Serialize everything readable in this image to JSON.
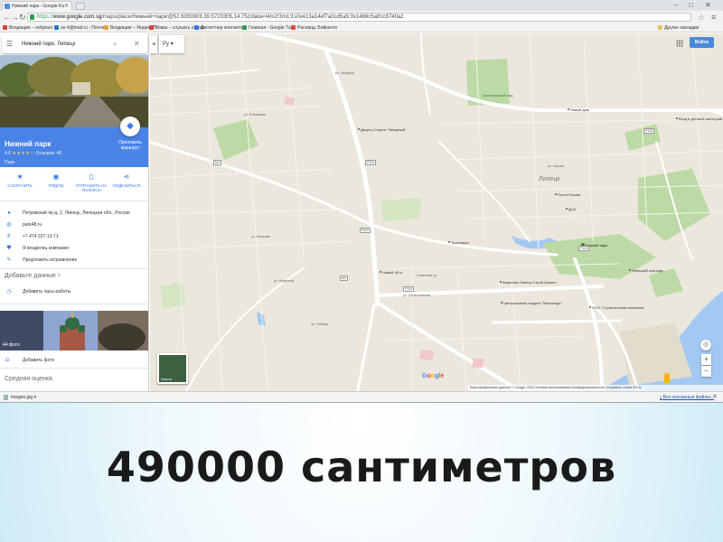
{
  "browser": {
    "tab_title": "Нижний парк - Google Ka",
    "address_scheme": "https://",
    "address_host": "www.google.com.sg",
    "address_path": "/maps/place/Нижний+парк/@52.6093903,39.5720305,14.75z/data=!4m2!3m1!1s0x413a14ef7a0cd5a5:0x14b6c5a81c8740a2",
    "bookmarks": [
      {
        "label": "Входящие – evbpezo",
        "color": "#d44638"
      },
      {
        "label": "ze-4@mail.ru - Почта",
        "color": "#2a77c7"
      },
      {
        "label": "Входящие – Яндекс.П",
        "color": "#e6a23c"
      },
      {
        "label": "Мама – слушать онлай",
        "color": "#d44638"
      },
      {
        "label": "Диспетчер контактов",
        "color": "#3b78e7"
      },
      {
        "label": "Главная - Google Таб",
        "color": "#2e9d4e"
      },
      {
        "label": "Рисовод: Бойкенто",
        "color": "#e04b36"
      }
    ],
    "other_bookmarks": "Другие закладки"
  },
  "panel": {
    "search_query": "Нижний парк, Липецк",
    "place_name": "Нижний парк",
    "rating": "4,6",
    "stars": "★★★★☆",
    "reviews": "Отзывов: 46",
    "place_type": "Парк",
    "route_label": "Проложить маршрут",
    "actions": [
      {
        "icon": "★",
        "label": "СОХРАНИТЬ",
        "name": "save"
      },
      {
        "icon": "◉",
        "label": "РЯДОМ",
        "name": "nearby"
      },
      {
        "icon": "▯",
        "label": "ОТПРАВИТЬ НА ТЕЛЕФОН",
        "name": "send-to-phone"
      },
      {
        "icon": "⋖",
        "label": "ПОДЕЛИТЬСЯ",
        "name": "share"
      }
    ],
    "address": "Петровский пр-д, 2, Липецк, Липецкая обл., Россия",
    "website": "park48.ru",
    "phone": "+7 474 227-13-71",
    "claim": "Я владелец компании",
    "suggest_edit": "Предложить исправление",
    "add_missing_title": "Добавьте данные",
    "add_hours": "Добавить часы работы",
    "photo_count": "44 фото",
    "add_photo": "Добавить фото",
    "avg_rating_title": "Средняя оценка"
  },
  "map": {
    "lang_label": "Ру",
    "signin_label": "Войти",
    "earth_label": "Земля",
    "city": "Липецк",
    "park_label": "Нижний парк",
    "labels": [
      {
        "text": "Дворец Спорта \"Звездный\"",
        "kind": "poi"
      },
      {
        "text": "Новый дом",
        "kind": "poi"
      },
      {
        "text": "Вход в детский санаторий Ростовский",
        "kind": "poi"
      },
      {
        "text": "Почта России",
        "kind": "poi"
      },
      {
        "text": "ДСК",
        "kind": "poi"
      },
      {
        "text": "Трансфорт",
        "kind": "poi"
      },
      {
        "text": "Новый 48 гк",
        "kind": "poi"
      },
      {
        "text": "Кварталы Липецк Строй Альянс",
        "kind": "poi"
      },
      {
        "text": "Центральный стадион \"Металлург\"",
        "kind": "poi"
      },
      {
        "text": "ООО \"Строительная компания\"",
        "kind": "poi"
      },
      {
        "text": "Липецкий колледж",
        "kind": "poi"
      },
      {
        "text": "Ботанический сад",
        "kind": "park"
      },
      {
        "text": "ул. Гагарина",
        "kind": "street"
      },
      {
        "text": "Советская ул.",
        "kind": "street"
      },
      {
        "text": "ул. Первомайская",
        "kind": "street"
      },
      {
        "text": "ул. Плеханова",
        "kind": "street"
      },
      {
        "text": "ул. Катукова",
        "kind": "street"
      },
      {
        "text": "ул. Неделина",
        "kind": "street"
      },
      {
        "text": "пр. Победы",
        "kind": "street"
      },
      {
        "text": "ул. Кирова",
        "kind": "street"
      },
      {
        "text": "Р119",
        "kind": "shield"
      },
      {
        "text": "Р119",
        "kind": "shield"
      },
      {
        "text": "Р119",
        "kind": "shield"
      },
      {
        "text": "Р119",
        "kind": "shield"
      },
      {
        "text": "Р119",
        "kind": "shield"
      },
      {
        "text": "М4",
        "kind": "shield"
      },
      {
        "text": "М4",
        "kind": "shield"
      }
    ],
    "google_logo": [
      "G",
      "o",
      "o",
      "g",
      "l",
      "e"
    ],
    "attribution": "Картографические данные © Google, 2016   Условия использования   Конфиденциальность   Отправить отзыв   200 м"
  },
  "downloads": {
    "file": "images.jpg",
    "show_all": "Все скачанные файлы..."
  },
  "caption": "490000 сантиметров"
}
